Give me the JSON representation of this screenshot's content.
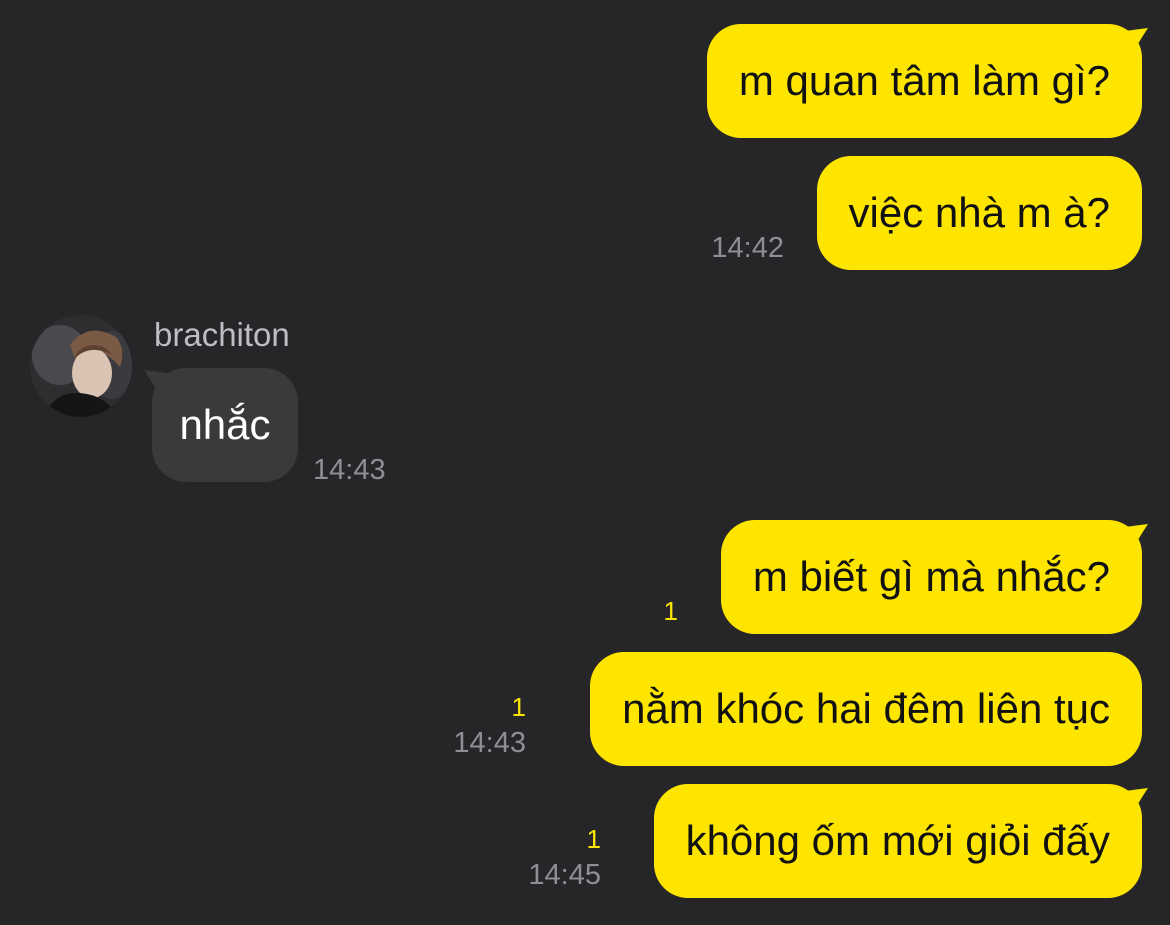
{
  "chat": {
    "contact_name": "brachiton",
    "messages": [
      {
        "side": "out",
        "text": "m quan tâm làm gì?"
      },
      {
        "side": "out",
        "text": "việc nhà m à?",
        "time": "14:42"
      },
      {
        "side": "in",
        "text": "nhắc",
        "time": "14:43"
      },
      {
        "side": "out",
        "text": "m biết gì mà nhắc?",
        "unread": "1"
      },
      {
        "side": "out",
        "text": "nằm khóc hai đêm liên tục",
        "unread": "1",
        "time": "14:43"
      },
      {
        "side": "out",
        "text": "không ốm mới giỏi đấy",
        "unread": "1",
        "time": "14:45"
      }
    ]
  },
  "colors": {
    "background": "#262628",
    "outgoing_bubble": "#FEE500",
    "incoming_bubble": "#3a3a3c",
    "timestamp": "#8e8e93",
    "unread_count": "#FEE500"
  },
  "icons": {
    "avatar": "profile-photo"
  }
}
